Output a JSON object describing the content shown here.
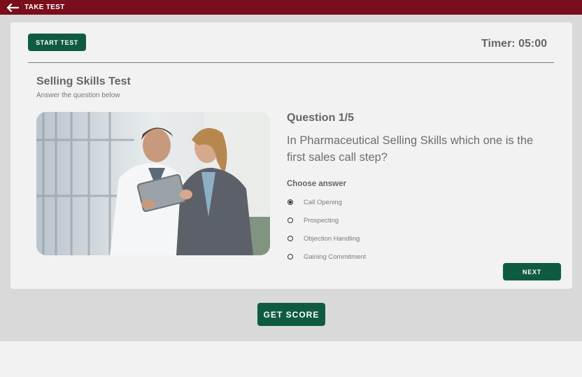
{
  "header": {
    "title": "TAKE TEST",
    "back_icon": "arrow-left-icon",
    "background": "#7a0e1c"
  },
  "test": {
    "start_label": "START TEST",
    "timer": "Timer: 05:00",
    "title": "Selling Skills Test",
    "subtitle": "Answer the question below"
  },
  "question": {
    "number": "Question 1/5",
    "text": "In Pharmaceutical Selling Skills which one is the first sales call step?",
    "choose_label": "Choose answer",
    "options": [
      {
        "label": "Call Opening",
        "selected": true
      },
      {
        "label": "Prospecting",
        "selected": false
      },
      {
        "label": "Objection Handling",
        "selected": false
      },
      {
        "label": "Gaining Commitment",
        "selected": false
      }
    ]
  },
  "actions": {
    "next_label": "NEXT",
    "score_label": "GET SCORE",
    "accent": "#0f5b41"
  }
}
